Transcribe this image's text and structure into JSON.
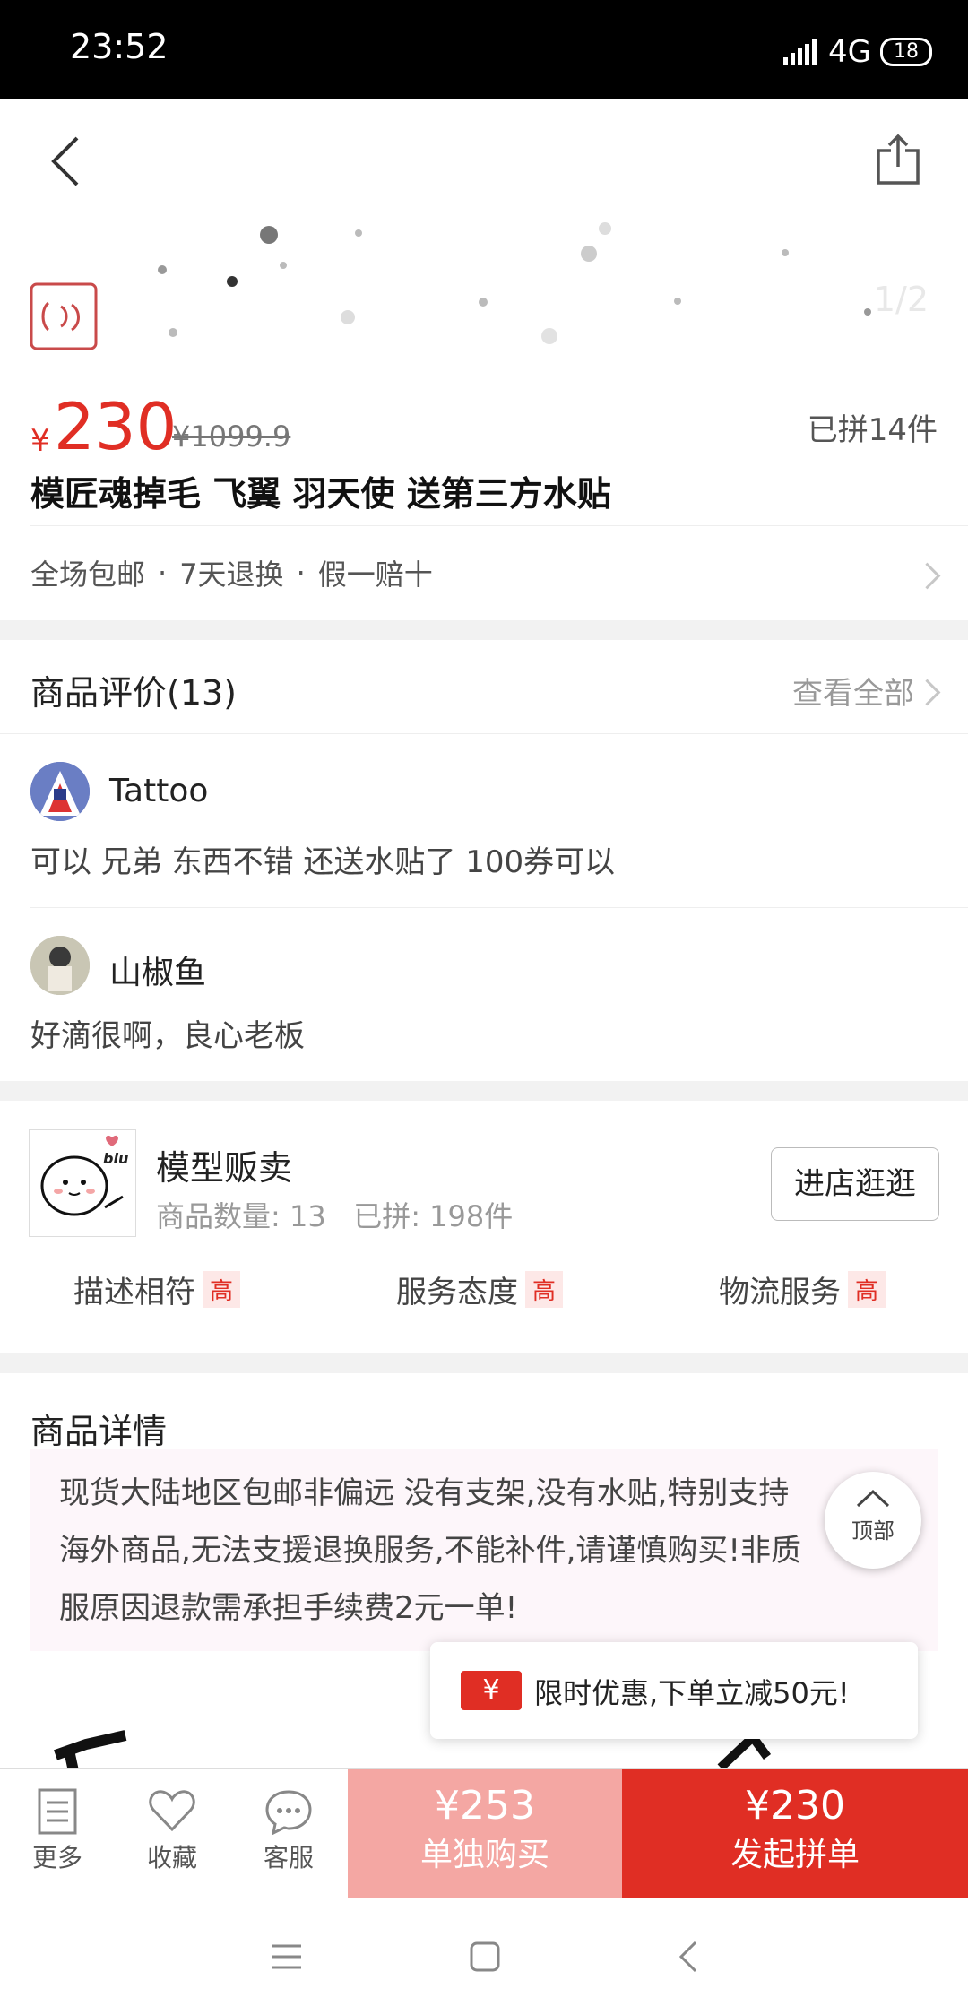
{
  "status": {
    "time": "23:52",
    "network": "4G",
    "battery": "18"
  },
  "banner": {
    "page_indicator": "1/2"
  },
  "product": {
    "currency": "¥",
    "price": "230",
    "original_price": "¥1099.9",
    "sold": "已拼14件",
    "title": "模匠魂掉毛 飞翼 羽天使  送第三方水贴"
  },
  "services": {
    "items": [
      "全场包邮",
      "7天退换",
      "假一赔十"
    ],
    "separator": "·"
  },
  "reviews": {
    "header": "商品评价(13)",
    "view_all": "查看全部",
    "list": [
      {
        "user": "Tattoo",
        "text": "可以 兄弟 东西不错 还送水贴了 100券可以"
      },
      {
        "user": "山椒鱼",
        "text": "好滴很啊，良心老板"
      }
    ]
  },
  "store": {
    "logo_text": "biu",
    "name": "模型贩卖",
    "stats": "商品数量: 13   已拼: 198件",
    "enter_button": "进店逛逛",
    "ratings": [
      {
        "label": "描述相符",
        "level": "高"
      },
      {
        "label": "服务态度",
        "level": "高"
      },
      {
        "label": "物流服务",
        "level": "高"
      }
    ]
  },
  "details": {
    "header": "商品详情",
    "notice_lines": [
      "现货大陆地区包邮非偏远 没有支架,没有水贴,特别支持",
      "海外商品,无法支援退换服务,不能补件,请谨慎购买!非质",
      "服原因退款需承担手续费2元一单!"
    ]
  },
  "top_button": {
    "label": "顶部"
  },
  "promo": {
    "icon": "¥",
    "text": "限时优惠,下单立减50元!"
  },
  "bottom_bar": {
    "more": "更多",
    "favorite": "收藏",
    "service": "客服",
    "single_price": "¥253",
    "single_label": "单独购买",
    "group_price": "¥230",
    "group_label": "发起拼单"
  },
  "colors": {
    "accent": "#e02e24",
    "single_buy_bg": "#f4a7a3",
    "notice_bg": "#fdf6fa"
  }
}
